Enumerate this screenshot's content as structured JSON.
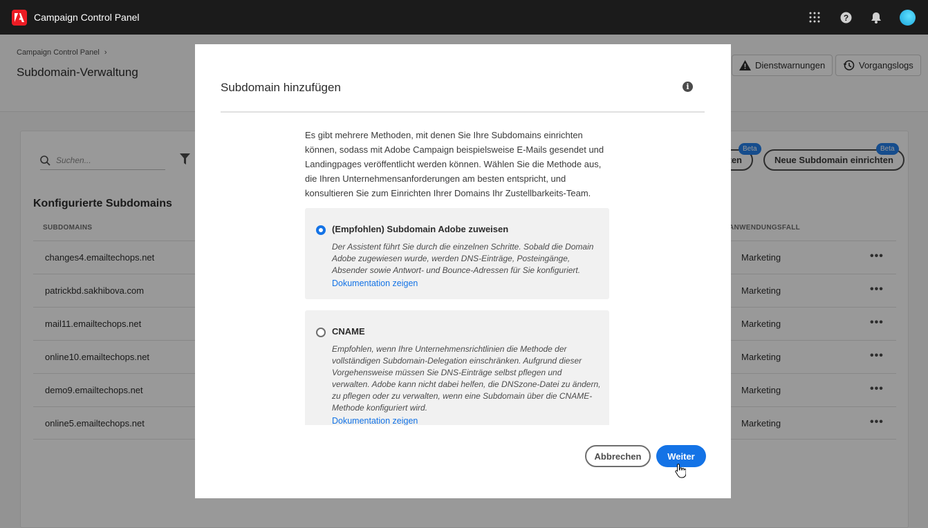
{
  "app": {
    "title": "Campaign Control Panel"
  },
  "header": {
    "breadcrumb": "Campaign Control Panel",
    "page_title": "Subdomain-Verwaltung",
    "service_alerts": "Dienstwarnungen",
    "process_logs": "Vorgangslogs"
  },
  "toolbar": {
    "search_placeholder": "Suchen...",
    "pill_partial": "ten",
    "new_subdomain": "Neue Subdomain einrichten",
    "beta": "Beta"
  },
  "list": {
    "section_title": "Konfigurierte Subdomains",
    "col_subdomains": "SUBDOMAINS",
    "col_use_case": "ANWENDUNGSFALL",
    "rows": [
      {
        "domain": "changes4.emailtechops.net",
        "use_case": "Marketing"
      },
      {
        "domain": "patrickbd.sakhibova.com",
        "use_case": "Marketing"
      },
      {
        "domain": "mail11.emailtechops.net",
        "use_case": "Marketing"
      },
      {
        "domain": "online10.emailtechops.net",
        "use_case": "Marketing"
      },
      {
        "domain": "demo9.emailtechops.net",
        "use_case": "Marketing"
      },
      {
        "domain": "online5.emailtechops.net",
        "use_case": "Marketing"
      }
    ],
    "more": "•••"
  },
  "modal": {
    "title": "Subdomain hinzufügen",
    "intro": "Es gibt mehrere Methoden, mit denen Sie Ihre Subdomains einrichten können, sodass mit Adobe Campaign beispielsweise E-Mails gesendet und Landingpages veröffentlicht werden können. Wählen Sie die Methode aus, die Ihren Unternehmensanforderungen am besten entspricht, und konsultieren Sie zum Einrichten Ihrer Domains Ihr Zustellbarkeits-Team.",
    "option1": {
      "title": "(Empfohlen) Subdomain Adobe zuweisen",
      "description": "Der Assistent führt Sie durch die einzelnen Schritte. Sobald die Domain Adobe zugewiesen wurde, werden DNS-Einträge, Posteingänge, Absender sowie Antwort- und Bounce-Adressen für Sie konfiguriert.",
      "link": "Dokumentation zeigen",
      "selected": true
    },
    "option2": {
      "title": "CNAME",
      "description": "Empfohlen, wenn Ihre Unternehmensrichtlinien die Methode der vollständigen Subdomain-Delegation einschränken. Aufgrund dieser Vorgehensweise müssen Sie DNS-Einträge selbst pflegen und verwalten. Adobe kann nicht dabei helfen, die DNSzone-Datei zu ändern, zu pflegen oder zu verwalten, wenn eine Subdomain über die CNAME-Methode konfiguriert wird.",
      "link": "Dokumentation zeigen",
      "selected": false
    },
    "cancel": "Abbrechen",
    "next": "Weiter"
  },
  "colors": {
    "accent": "#1473e6",
    "topbar": "#1b1b1b",
    "brand": "#ec1c24"
  }
}
